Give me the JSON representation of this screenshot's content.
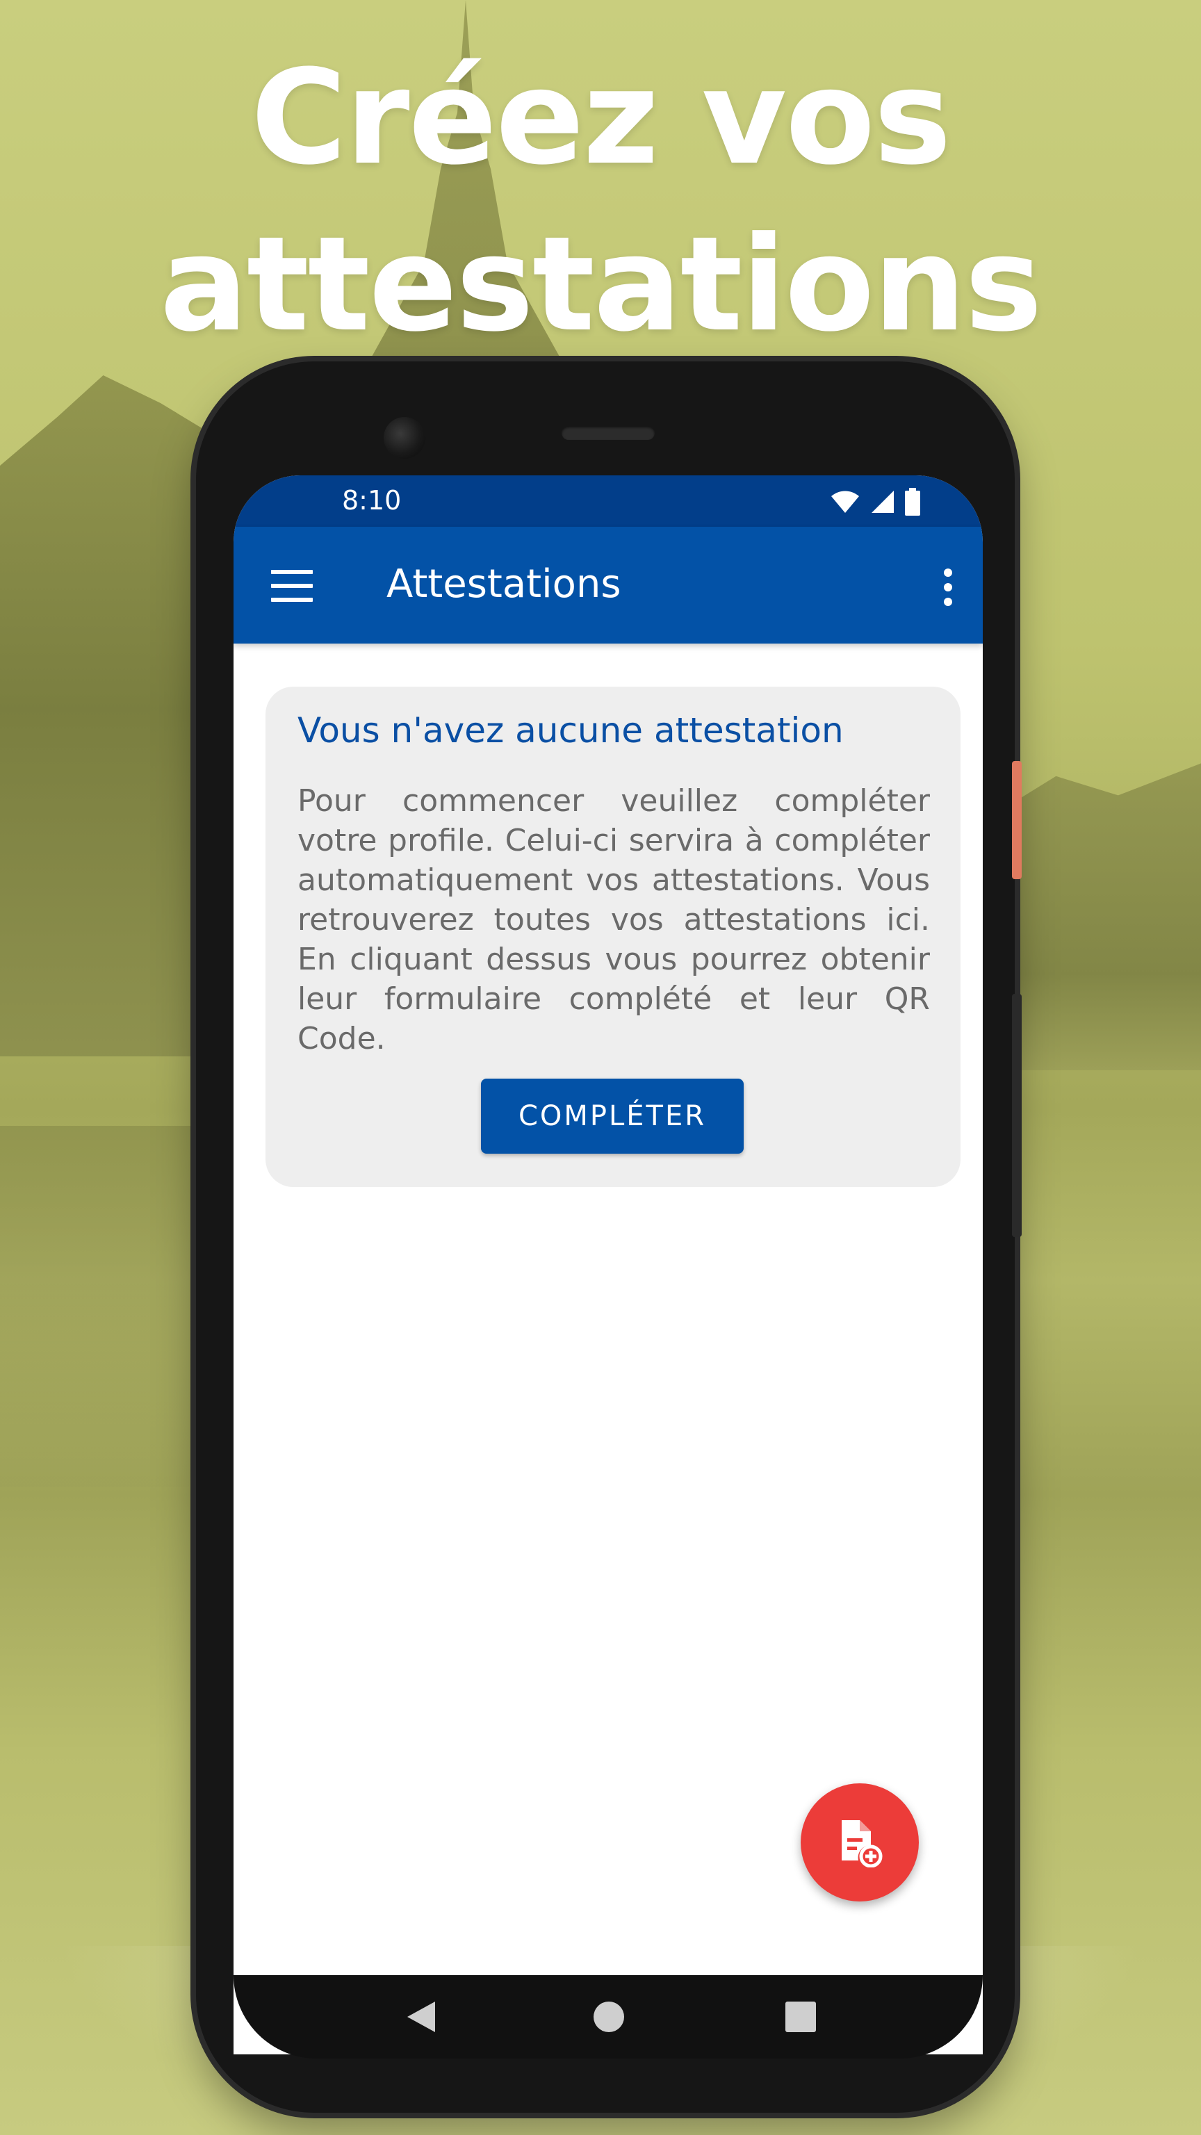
{
  "headline": {
    "line1": "Créez vos",
    "line2": "attestations"
  },
  "status_bar": {
    "time": "8:10",
    "icons": [
      "wifi-icon",
      "signal-icon",
      "battery-icon"
    ]
  },
  "app_bar": {
    "title": "Attestations",
    "menu_icon": "hamburger-menu-icon",
    "overflow_icon": "more-vert-icon"
  },
  "empty_card": {
    "title": "Vous n'avez aucune attestation",
    "body": "Pour commencer veuillez compléter votre profile. Celui-ci servira à compléter automatiquement vos attestations. Vous retrouverez toutes vos attestations ici. En cliquant dessus vous pourrez obtenir leur formulaire complété et leur QR Code.",
    "button_label": "COMPLÉTER"
  },
  "fab": {
    "icon": "add-document-icon"
  },
  "nav_bar": {
    "icons": [
      "back-icon",
      "home-icon",
      "recents-icon"
    ]
  },
  "colors": {
    "primary": "#0352a7",
    "status_bar": "#023e8a",
    "fab": "#ec3c39",
    "card_bg": "#eeeeee",
    "background": "#b8bd6a"
  }
}
